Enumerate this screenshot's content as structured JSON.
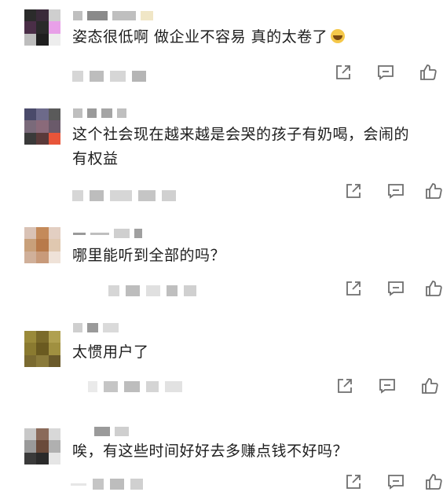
{
  "comments": [
    {
      "text_lines": [
        "姿态很低啊  做企业不容易 真的太卷了"
      ],
      "emoji": "grimace-emoji"
    },
    {
      "text_lines": [
        "这个社会现在越来越是会哭的孩子有奶喝，会闹的",
        "有权益"
      ]
    },
    {
      "text_lines": [
        "哪里能听到全部的吗？"
      ]
    },
    {
      "text_lines": [
        "太惯用户了"
      ]
    },
    {
      "text_lines": [
        "唉，有这些时间好好去多赚点钱不好吗？"
      ]
    }
  ],
  "icons": {
    "share": "share-icon",
    "reply": "comment-icon",
    "like": "thumbs-up-icon"
  },
  "colors": {
    "text": "#1d1d1d",
    "icon": "#6f6f6f",
    "blur": "#c8c8c8"
  }
}
